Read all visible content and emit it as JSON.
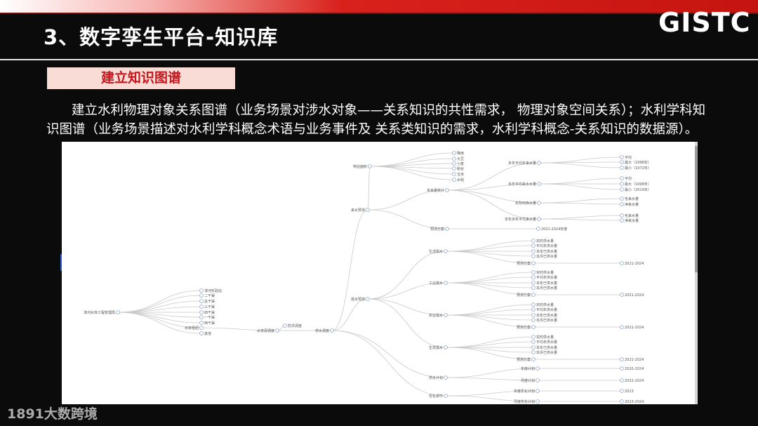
{
  "header": {
    "title": "3、数字孪生平台-知识库",
    "logo": "GISTC"
  },
  "section": {
    "label": "建立知识图谱"
  },
  "paragraph": {
    "line1": "建立水利物理对象关系图谱（业务场景对涉水对象——关系知识的共性需求， 物理对象空间关系）；水利学科知",
    "line2": "识图谱（业务场景描述对水利学科概念术语与业务事件及 关系类知识的需求，水利学科概念-关系知识的数据源）。"
  },
  "watermark": "1891大数跨境",
  "graph": {
    "nodes": [
      {
        "id": "root",
        "label": "漳河水库工程管理局"
      },
      {
        "id": "a1",
        "label": "漳河实验站"
      },
      {
        "id": "a2",
        "label": "二干渠"
      },
      {
        "id": "a3",
        "label": "总干渠"
      },
      {
        "id": "a4",
        "label": "三干渠"
      },
      {
        "id": "a5",
        "label": "四干渠"
      },
      {
        "id": "a6",
        "label": "一干渠"
      },
      {
        "id": "a7",
        "label": "西干渠"
      },
      {
        "id": "sy",
        "label": "水库枢纽"
      },
      {
        "id": "a9",
        "label": "其他"
      },
      {
        "id": "ss",
        "label": "水资源调度"
      },
      {
        "id": "fh",
        "label": "防洪调度"
      },
      {
        "id": "gs",
        "label": "供水调度"
      },
      {
        "id": "ls",
        "label": "来水预测"
      },
      {
        "id": "xs",
        "label": "需水预测"
      },
      {
        "id": "t0",
        "label": "特征面积"
      },
      {
        "id": "t1",
        "label": "降雨"
      },
      {
        "id": "t2",
        "label": "大豆"
      },
      {
        "id": "t3",
        "label": "小麦"
      },
      {
        "id": "t4",
        "label": "稻谷"
      },
      {
        "id": "t5",
        "label": "玉米"
      },
      {
        "id": "t6",
        "label": "水稻"
      },
      {
        "id": "wl",
        "label": "未来量统计"
      },
      {
        "id": "yf",
        "label": "预测方案"
      },
      {
        "id": "yf1",
        "label": "2021-2024年度"
      },
      {
        "id": "d1",
        "label": "多年平均年来水量"
      },
      {
        "id": "d1a",
        "label": "平均"
      },
      {
        "id": "d1b",
        "label": "最大（1998年）"
      },
      {
        "id": "d1c",
        "label": "最小（1972年）"
      },
      {
        "id": "d2",
        "label": "多年平均来水水量"
      },
      {
        "id": "d2a",
        "label": "平均"
      },
      {
        "id": "d2b",
        "label": "最大（1998年）"
      },
      {
        "id": "d2c",
        "label": "最小（2019年）"
      },
      {
        "id": "d3",
        "label": "年际出库水量"
      },
      {
        "id": "d3a",
        "label": "毛来水量"
      },
      {
        "id": "d3b",
        "label": "净来水量"
      },
      {
        "id": "d4",
        "label": "本年多年平均来水量"
      },
      {
        "id": "d4a",
        "label": "毛来水量"
      },
      {
        "id": "d4b",
        "label": "净来水量"
      },
      {
        "id": "sh",
        "label": "生活需水"
      },
      {
        "id": "gy",
        "label": "工业需水"
      },
      {
        "id": "ny",
        "label": "农业需水"
      },
      {
        "id": "st",
        "label": "生态需水"
      },
      {
        "id": "k1",
        "label": "实时供水量"
      },
      {
        "id": "k2",
        "label": "平均年供水量"
      },
      {
        "id": "k3",
        "label": "本年已供水量"
      },
      {
        "id": "k4",
        "label": "本月已供水量"
      },
      {
        "id": "k5",
        "label": "预测方案"
      },
      {
        "id": "k6",
        "label": "2021-2024"
      },
      {
        "id": "jh",
        "label": "供水计划"
      },
      {
        "id": "j1",
        "label": "年度计划"
      },
      {
        "id": "j2",
        "label": "月度计划"
      },
      {
        "id": "j1y",
        "label": "2020-2024"
      },
      {
        "id": "j2y",
        "label": "2022-2024"
      },
      {
        "id": "yh",
        "label": "优化调节"
      },
      {
        "id": "y1",
        "label": "年度优化计划"
      },
      {
        "id": "y2",
        "label": "月度优化计划"
      },
      {
        "id": "y1y",
        "label": "2023"
      },
      {
        "id": "y2y",
        "label": "2023-2024"
      }
    ]
  }
}
